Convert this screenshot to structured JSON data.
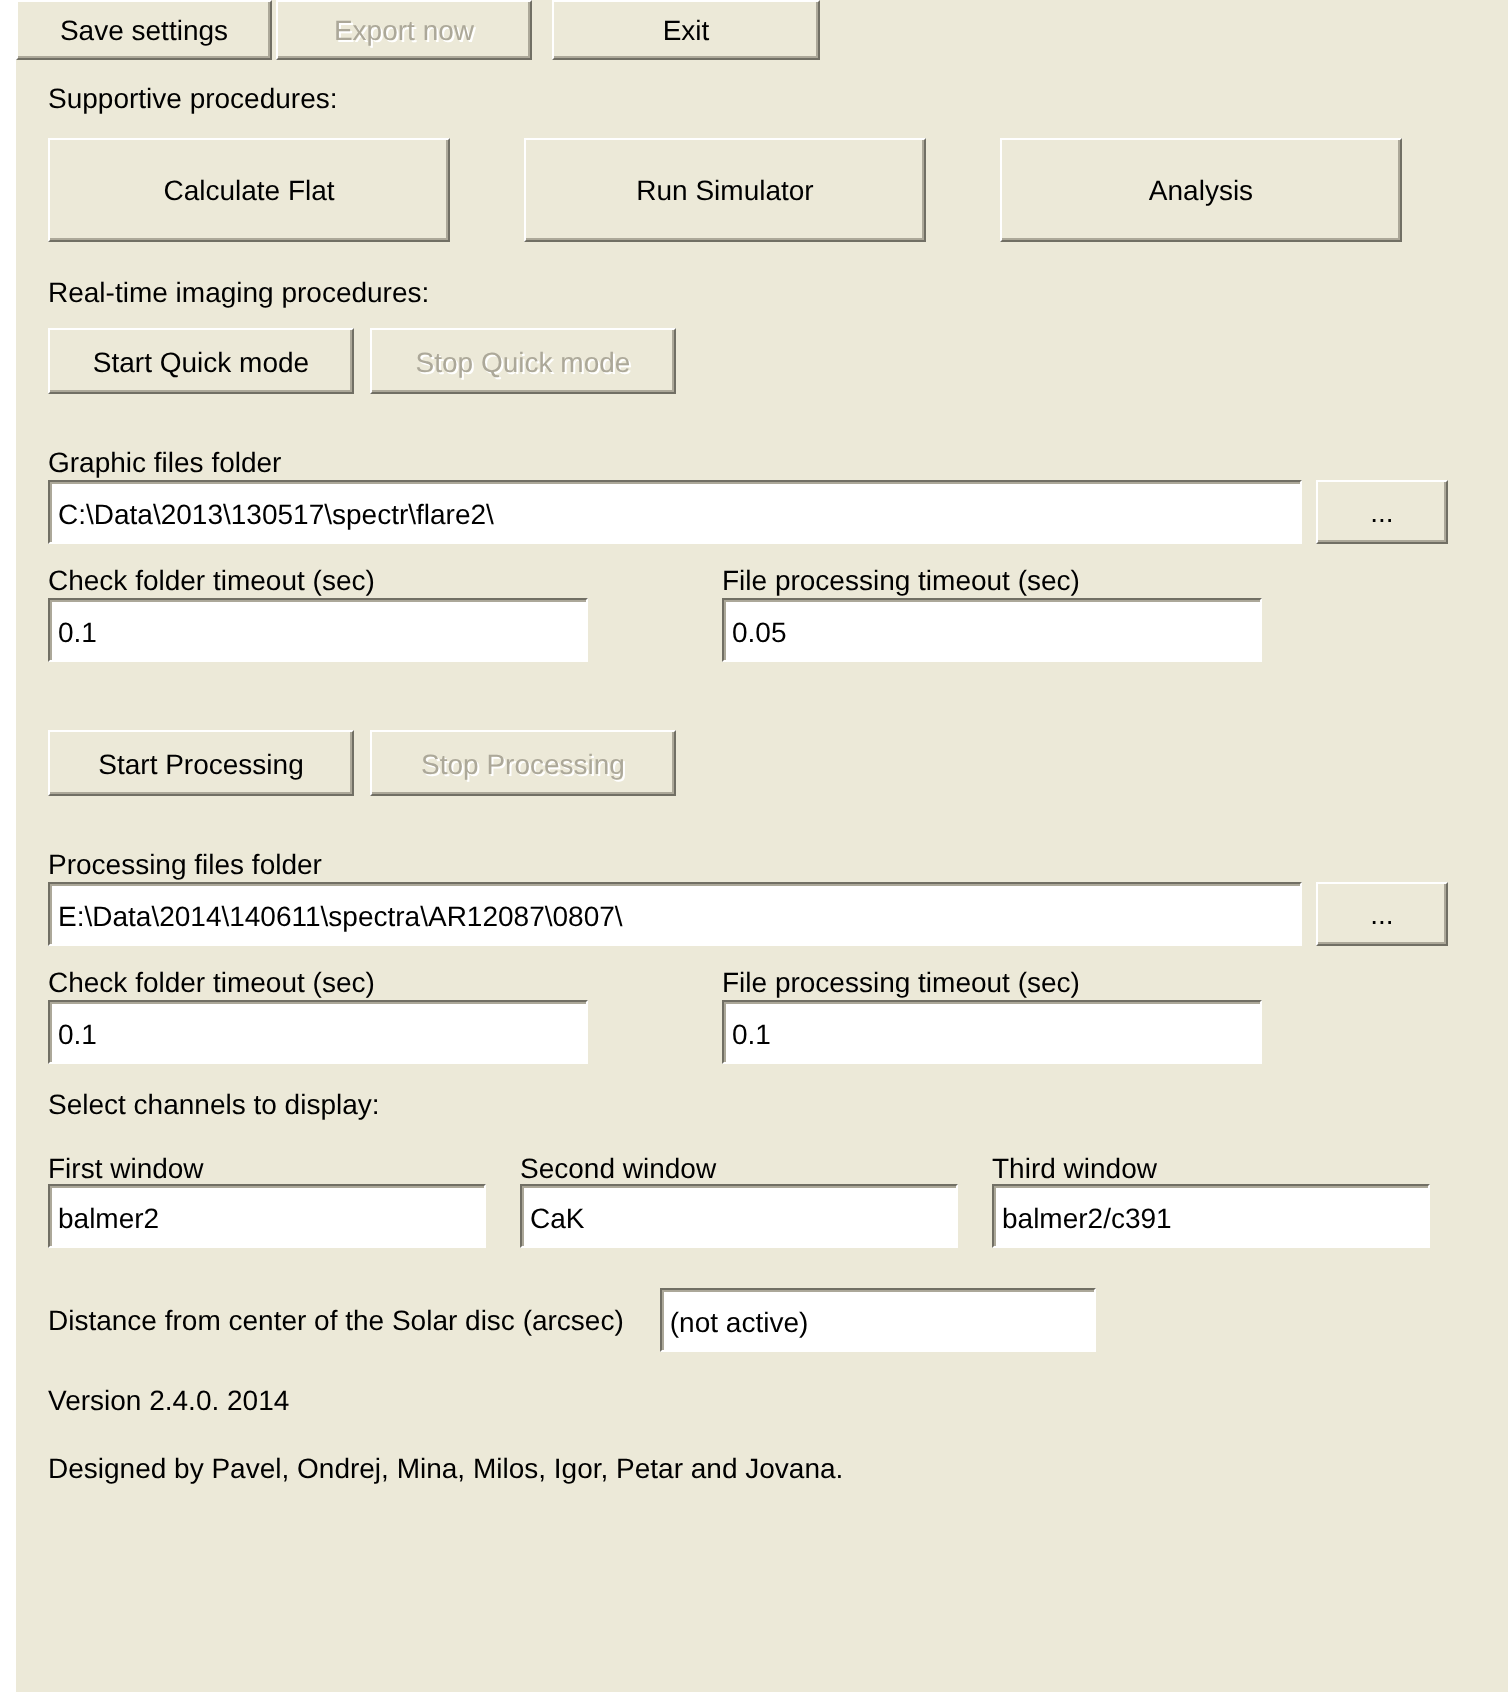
{
  "toolbar": [
    {
      "label": "Save settings",
      "disabled": false
    },
    {
      "label": "Export now",
      "disabled": true
    },
    {
      "label": "Exit",
      "disabled": false
    }
  ],
  "supportive": {
    "label": "Supportive procedures:",
    "buttons": [
      {
        "label": "Calculate Flat",
        "disabled": false
      },
      {
        "label": "Run Simulator",
        "disabled": false
      },
      {
        "label": "Analysis",
        "disabled": false
      }
    ]
  },
  "realtime": {
    "label": "Real-time imaging procedures:",
    "buttons": [
      {
        "label": "Start Quick mode",
        "disabled": false
      },
      {
        "label": "Stop Quick mode",
        "disabled": true
      }
    ],
    "folder": {
      "label": "Graphic files folder",
      "value": "C:\\Data\\2013\\130517\\spectr\\flare2\\",
      "browse": "..."
    },
    "timeouts": [
      {
        "label": "Check folder timeout (sec)",
        "value": "0.1"
      },
      {
        "label": "File processing timeout (sec)",
        "value": "0.05"
      }
    ]
  },
  "processing": {
    "buttons": [
      {
        "label": "Start Processing",
        "disabled": false
      },
      {
        "label": "Stop Processing",
        "disabled": true
      }
    ],
    "folder": {
      "label": "Processing files folder",
      "value": "E:\\Data\\2014\\140611\\spectra\\AR12087\\0807\\",
      "browse": "..."
    },
    "timeouts": [
      {
        "label": "Check folder timeout (sec)",
        "value": "0.1"
      },
      {
        "label": "File processing timeout (sec)",
        "value": "0.1"
      }
    ]
  },
  "channels": {
    "label": "Select channels to display:",
    "windows": [
      {
        "label": "First window",
        "value": "balmer2"
      },
      {
        "label": "Second window",
        "value": "CaK"
      },
      {
        "label": "Third window",
        "value": "balmer2/c391"
      }
    ]
  },
  "distance": {
    "label": "Distance from center of the Solar disc (arcsec)",
    "value": "(not active)"
  },
  "version": "Version 2.4.0. 2014",
  "credits": "Designed by Pavel, Ondrej, Mina, Milos, Igor, Petar and Jovana."
}
